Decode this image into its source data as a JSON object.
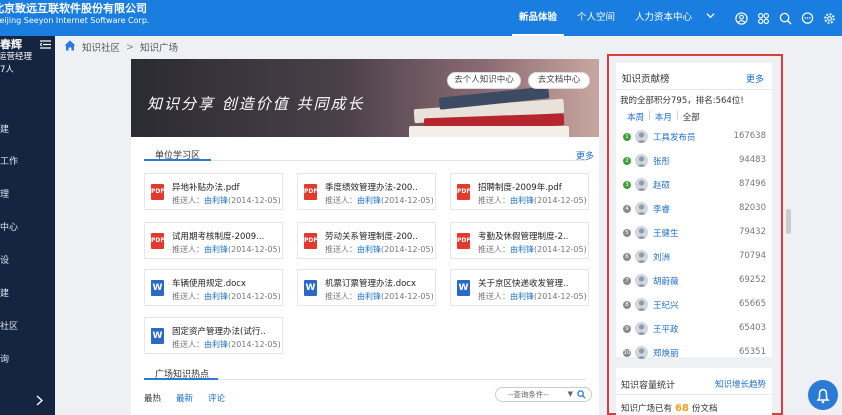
{
  "header": {
    "company_cn": "北京致远互联软件股份有限公司",
    "company_en": "Beijing Seeyon Internet Software Corp.",
    "nav": [
      "新品体验",
      "个人空间",
      "人力资本中心"
    ],
    "icons": [
      "user-circle-icon",
      "apps-grid-icon",
      "search-icon",
      "chat-icon",
      "gear-icon"
    ]
  },
  "sidebar": {
    "user_name": "春辉",
    "user_role": "运营经理",
    "user_count": "7人",
    "items": [
      "建",
      "工作",
      "理",
      "中心",
      "设",
      "建",
      "社区",
      "询"
    ]
  },
  "breadcrumb": [
    "知识社区",
    "知识广场"
  ],
  "banner": {
    "slogan": "知识分享 创造价值 共同成长",
    "btn_personal": "去个人知识中心",
    "btn_doc": "去文档中心"
  },
  "unit_section": {
    "title": "单位学习区",
    "more": "更多",
    "sender_label": "推送人：",
    "docs": [
      {
        "type": "pdf",
        "name": "异地补贴办法.pdf",
        "sender": "由利锋",
        "date": "(2014-12-05)"
      },
      {
        "type": "pdf",
        "name": "季度绩效管理办法-200..",
        "sender": "由利锋",
        "date": "(2014-12-05)"
      },
      {
        "type": "pdf",
        "name": "招聘制度-2009年.pdf",
        "sender": "由利锋",
        "date": "(2014-12-05)"
      },
      {
        "type": "pdf",
        "name": "试用期考核制度-2009...",
        "sender": "由利锋",
        "date": "(2014-12-05)"
      },
      {
        "type": "pdf",
        "name": "劳动关系管理制度-200..",
        "sender": "由利锋",
        "date": "(2014-12-05)"
      },
      {
        "type": "pdf",
        "name": "考勤及休假管理制度-2..",
        "sender": "由利锋",
        "date": "(2014-12-05)"
      },
      {
        "type": "docx",
        "name": "车辆使用规定.docx",
        "sender": "由利锋",
        "date": "(2014-12-05)"
      },
      {
        "type": "docx",
        "name": "机票订票管理办法.docx",
        "sender": "由利锋",
        "date": "(2014-12-05)"
      },
      {
        "type": "docx",
        "name": "关于京区快递收发管理..",
        "sender": "由利锋",
        "date": "(2014-12-05)"
      },
      {
        "type": "docx",
        "name": "固定资产管理办法(试行..",
        "sender": "由利锋",
        "date": "(2014-12-05)"
      }
    ]
  },
  "hot_section": {
    "title": "广场知识热点",
    "tabs": [
      "最热",
      "最新",
      "评论"
    ],
    "query_placeholder": "--查询条件--"
  },
  "ranking": {
    "title": "知识贡献榜",
    "more": "更多",
    "summary": "我的全部积分795，排名:564位!",
    "tabs": [
      "本周",
      "本月",
      "全部"
    ],
    "rows": [
      {
        "rank": "1",
        "name": "工具发布员",
        "score": "167638",
        "medal": "#3aa13a"
      },
      {
        "rank": "2",
        "name": "张彤",
        "score": "94483",
        "medal": "#3aa13a"
      },
      {
        "rank": "3",
        "name": "赵硕",
        "score": "87496",
        "medal": "#3aa13a"
      },
      {
        "rank": "4",
        "name": "李睿",
        "score": "82030",
        "medal": "#8a8a8a"
      },
      {
        "rank": "5",
        "name": "王健生",
        "score": "79432",
        "medal": "#8a8a8a"
      },
      {
        "rank": "6",
        "name": "刘洲",
        "score": "70794",
        "medal": "#8a8a8a"
      },
      {
        "rank": "7",
        "name": "胡蔚薇",
        "score": "69252",
        "medal": "#8a8a8a"
      },
      {
        "rank": "8",
        "name": "王纪兴",
        "score": "65665",
        "medal": "#8a8a8a"
      },
      {
        "rank": "9",
        "name": "王平政",
        "score": "65403",
        "medal": "#8a8a8a"
      },
      {
        "rank": "10",
        "name": "郑焕丽",
        "score": "65351",
        "medal": "#8a8a8a"
      }
    ]
  },
  "capacity": {
    "title": "知识容量统计",
    "trend": "知识增长趋势",
    "stat_prefix": "知识广场已有",
    "stat_num": "68",
    "stat_suffix": "份文档"
  },
  "colors": {
    "header": "#1a7de0",
    "sidebar": "#152541",
    "link": "#1a6fd1",
    "highlight_border": "#e03c3c",
    "pdf": "#e33a2d",
    "word": "#2b69c9"
  }
}
